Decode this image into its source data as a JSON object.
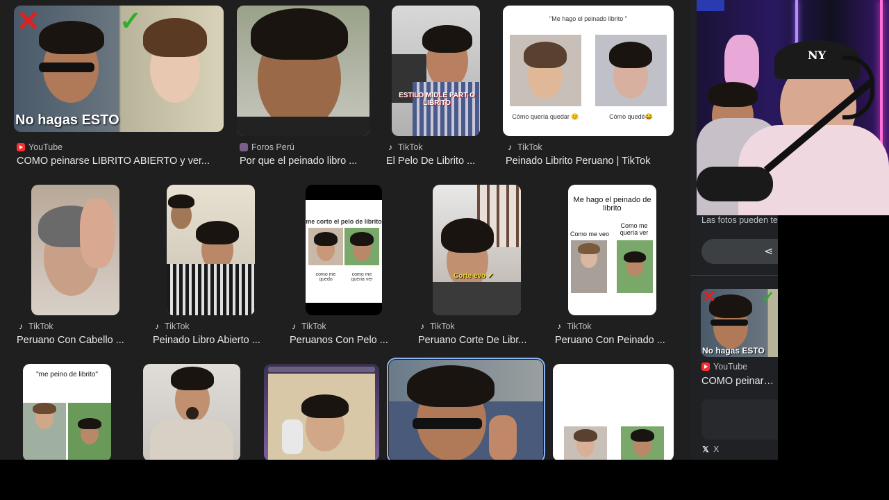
{
  "results": [
    {
      "source": "YouTube",
      "icon": "youtube-icon",
      "title": "COMO peinarse LIBRITO ABIERTO y ver...",
      "overlay": "No hagas ESTO"
    },
    {
      "source": "Foros Perú",
      "icon": "foros-peru-icon",
      "title": "Por que el peinado libro ..."
    },
    {
      "source": "TikTok",
      "icon": "tiktok-icon",
      "title": "El Pelo De Librito ...",
      "overlay": "ESTILO MIDLE PART O LIBRITO"
    },
    {
      "source": "TikTok",
      "icon": "tiktok-icon",
      "title": "Peinado Librito Peruano | TikTok",
      "doc_heading": "\"Me hago el peinado librito \"",
      "caption_left": "Cómo quería quedar 😊",
      "caption_right": "Cómo quedé😂"
    },
    {
      "source": "TikTok",
      "icon": "tiktok-icon",
      "title": "Peruano Con Cabello ..."
    },
    {
      "source": "TikTok",
      "icon": "tiktok-icon",
      "title": "Peinado Libro Abierto ..."
    },
    {
      "source": "TikTok",
      "icon": "tiktok-icon",
      "title": "Peruanos Con Pelo ...",
      "doc_heading": "me corto el pelo de librito",
      "caption_left": "como me quedo",
      "caption_right": "como me queria ver"
    },
    {
      "source": "TikTok",
      "icon": "tiktok-icon",
      "title": "Peruano Corte De Libr...",
      "overlay": "Corte evo ✔"
    },
    {
      "source": "TikTok",
      "icon": "tiktok-icon",
      "title": "Peruano Con Peinado ...",
      "doc_heading": "Me hago el peinado de librito",
      "caption_left": "Como me veo",
      "caption_right": "Como me quería ver"
    },
    {
      "doc_heading": "\"me peino de librito\""
    },
    {},
    {},
    {},
    {}
  ],
  "side_panel": {
    "disclaimer": "Las fotos pueden te",
    "share_icon": "share-icon",
    "related_source": "YouTube",
    "related_title": "COMO peinarse l",
    "related_overlay": "No hagas ESTO",
    "bottom_source": "X"
  },
  "webcam": {
    "cap_logo": "NY"
  },
  "colors": {
    "background": "#1f1f1f",
    "title": "#e8eaed",
    "source": "#bdc1c6",
    "selected": "#8ab4f8"
  }
}
